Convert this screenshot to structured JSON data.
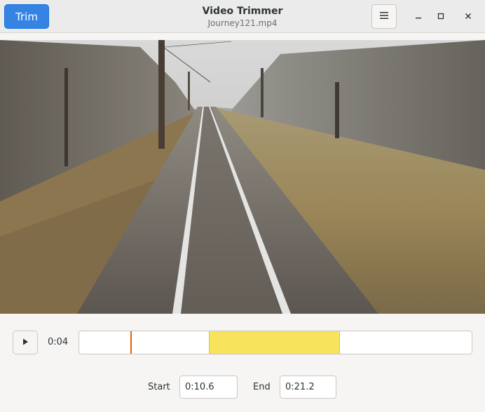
{
  "header": {
    "trim_label": "Trim",
    "title": "Video Trimmer",
    "subtitle": "Journey121.mp4",
    "menu_icon": "hamburger-menu-icon",
    "window_controls": [
      "minimize-icon",
      "maximize-icon",
      "close-icon"
    ]
  },
  "colors": {
    "accent": "#3584e4",
    "selection": "#f8e45c",
    "playhead": "#e66100"
  },
  "player": {
    "play_icon": "play-icon",
    "current_time": "0:04",
    "playhead_fraction": 0.13,
    "selection_start_fraction": 0.33,
    "selection_end_fraction": 0.665
  },
  "trim": {
    "start_label": "Start",
    "start_value": "0:10.6",
    "end_label": "End",
    "end_value": "0:21.2"
  }
}
